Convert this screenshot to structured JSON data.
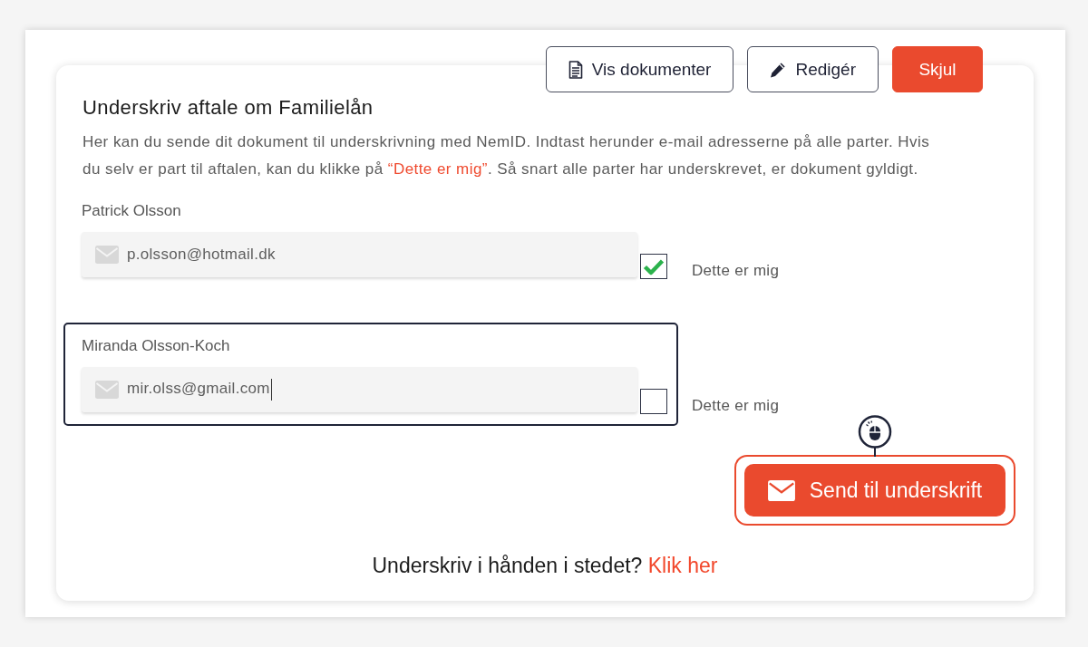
{
  "header_buttons": [
    {
      "kind": "documents",
      "label": "Vis dokumenter"
    },
    {
      "kind": "edit",
      "label": "Redigér"
    },
    {
      "kind": "primary",
      "label": "Skjul"
    }
  ],
  "title": "Underskriv aftale om Familielån",
  "description": [
    {
      "kind": "plain",
      "text": "Her kan du sende dit dokument til underskrivning med NemID. Indtast herunder e-mail adresserne på alle parter. Hvis du selv er part til aftalen, kan du klikke på "
    },
    {
      "kind": "emphasis",
      "text": "“Dette er mig”"
    },
    {
      "kind": "plain",
      "text": ". Så snart alle parter har underskrevet, er dokument gyldigt."
    }
  ],
  "parties": [
    {
      "name": "Patrick Olsson",
      "email": "p.olsson@hotmail.dk",
      "focused": false,
      "checked": true,
      "checkbox_label": "Dette er mig"
    },
    {
      "name": "Miranda Olsson-Koch",
      "email": "mir.olss@gmail.com",
      "focused": true,
      "checked": false,
      "checkbox_label": "Dette er mig"
    }
  ],
  "send_button": {
    "label": "Send til underskrift",
    "highlighted": true
  },
  "footer": {
    "question": "Underskriv i hånden i stedet?",
    "link": "Klik her"
  }
}
